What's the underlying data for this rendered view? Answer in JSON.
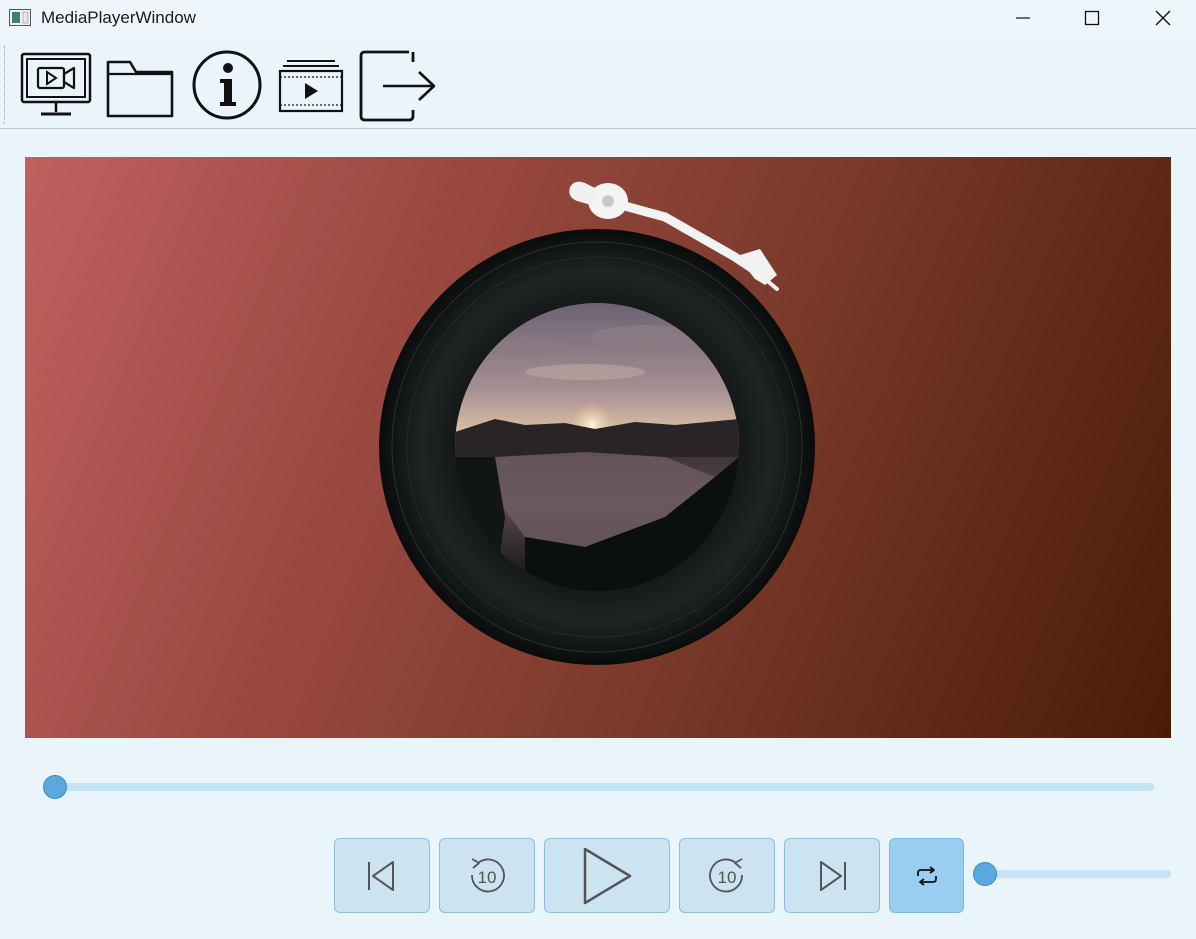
{
  "window": {
    "title": "MediaPlayerWindow",
    "buttons": [
      "minimize",
      "maximize",
      "close"
    ]
  },
  "toolbar": {
    "items": [
      {
        "name": "video-monitor-icon",
        "label": ""
      },
      {
        "name": "folder-icon",
        "label": ""
      },
      {
        "name": "info-icon",
        "label": "i"
      },
      {
        "name": "playlist-icon",
        "label": ""
      },
      {
        "name": "exit-icon",
        "label": ""
      }
    ]
  },
  "player": {
    "artwork": "vinyl-record-with-landscape-cover",
    "progress": 0.0,
    "volume": 0.0
  },
  "controls": {
    "previous": {
      "icon": "skip-previous-icon"
    },
    "rewind": {
      "icon": "rewind-10-icon",
      "label": "10"
    },
    "play": {
      "icon": "play-icon"
    },
    "forward": {
      "icon": "forward-10-icon",
      "label": "10"
    },
    "next": {
      "icon": "skip-next-icon"
    },
    "loop": {
      "icon": "loop-icon",
      "active": true
    }
  },
  "colors": {
    "accent": "#5aa8dc",
    "track": "#c4e3f4",
    "button_bg": "#cce4f2",
    "button_active_bg": "#99cdf1"
  }
}
